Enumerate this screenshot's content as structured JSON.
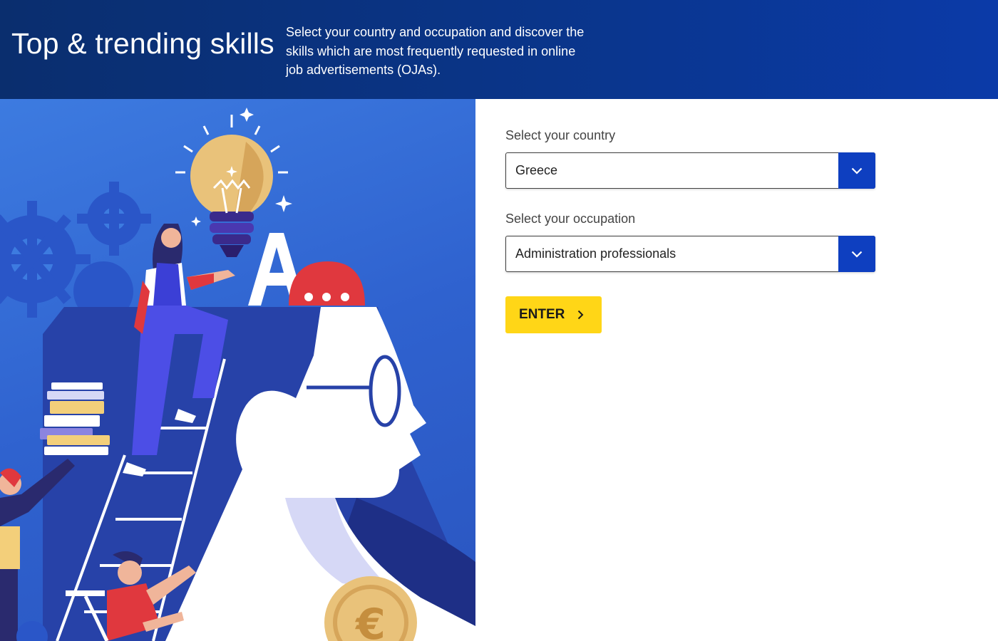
{
  "header": {
    "title": "Top & trending skills",
    "intro": "Select your country and occupation and discover the skills which are most frequently requested in online job advertisements (OJAs)."
  },
  "form": {
    "country": {
      "label": "Select your country",
      "value": "Greece",
      "icon": "chevron-down-icon"
    },
    "occupation": {
      "label": "Select your occupation",
      "value": "Administration professionals",
      "icon": "chevron-down-icon"
    },
    "enter_label": "ENTER",
    "enter_icon": "chevron-right-icon"
  },
  "colors": {
    "header_bg": "#0a358a",
    "dropdown_accent": "#0e3fc0",
    "button_bg": "#ffd617",
    "illustration_bg": "#3d7be0"
  }
}
